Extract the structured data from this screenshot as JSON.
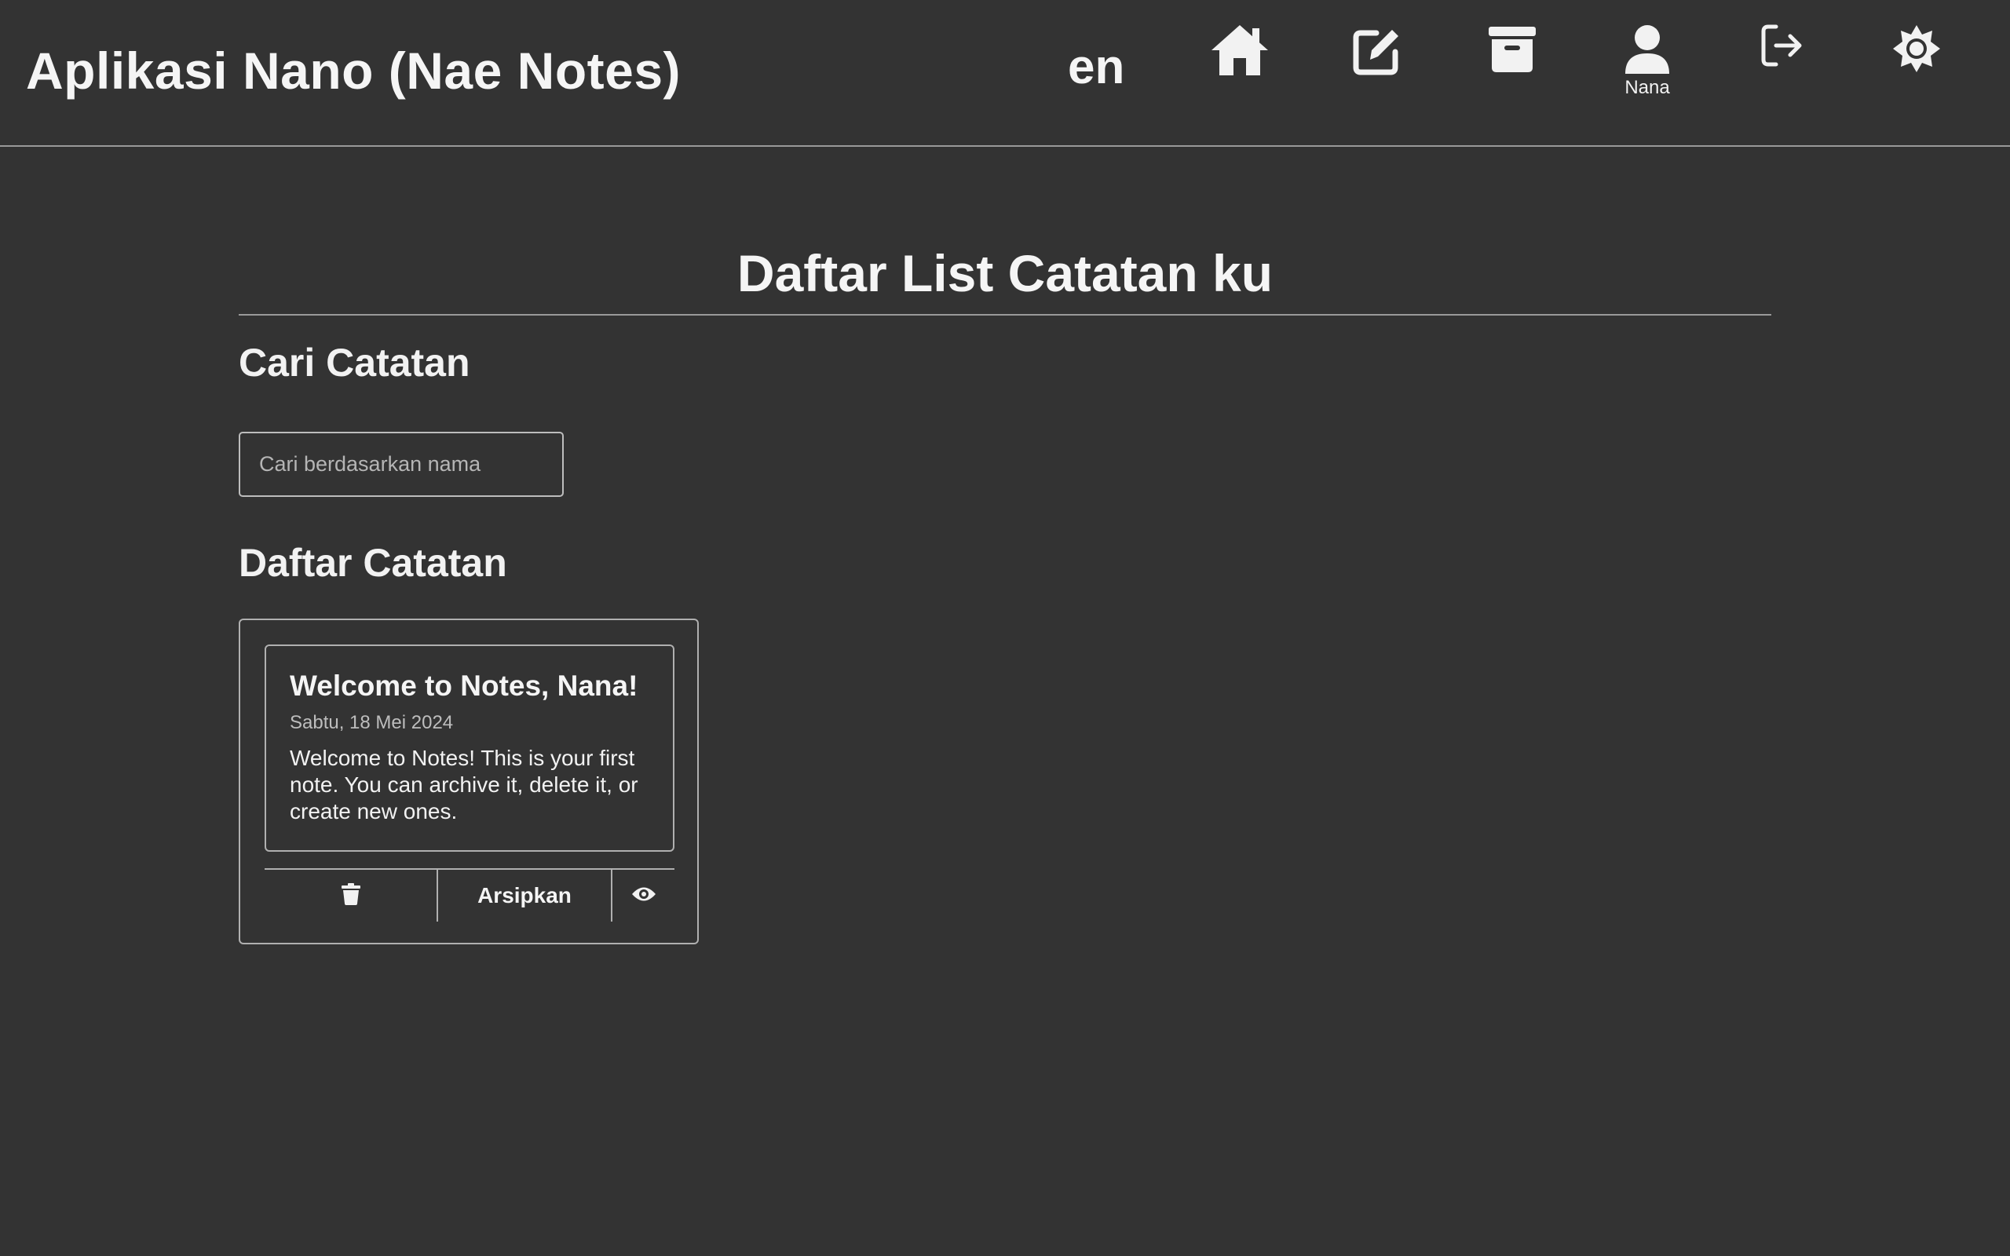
{
  "header": {
    "title": "Aplikasi Nano (Nae Notes)",
    "lang_toggle": "en",
    "user_name": "Nana",
    "icons": [
      "home-icon",
      "edit-icon",
      "archive-icon",
      "user-icon",
      "logout-icon",
      "theme-icon"
    ]
  },
  "main": {
    "heading": "Daftar List Catatan ku",
    "search": {
      "title": "Cari Catatan",
      "placeholder": "Cari berdasarkan nama",
      "value": ""
    },
    "list_title": "Daftar Catatan",
    "notes": [
      {
        "title": "Welcome to Notes, Nana!",
        "date": "Sabtu, 18 Mei 2024",
        "body": "Welcome to Notes! This is your first note. You can archive it, delete it, or create new ones.",
        "archive_label": "Arsipkan"
      }
    ]
  },
  "colors": {
    "background": "#333333",
    "text": "#f2f2f2",
    "border": "#b0b0b0"
  }
}
